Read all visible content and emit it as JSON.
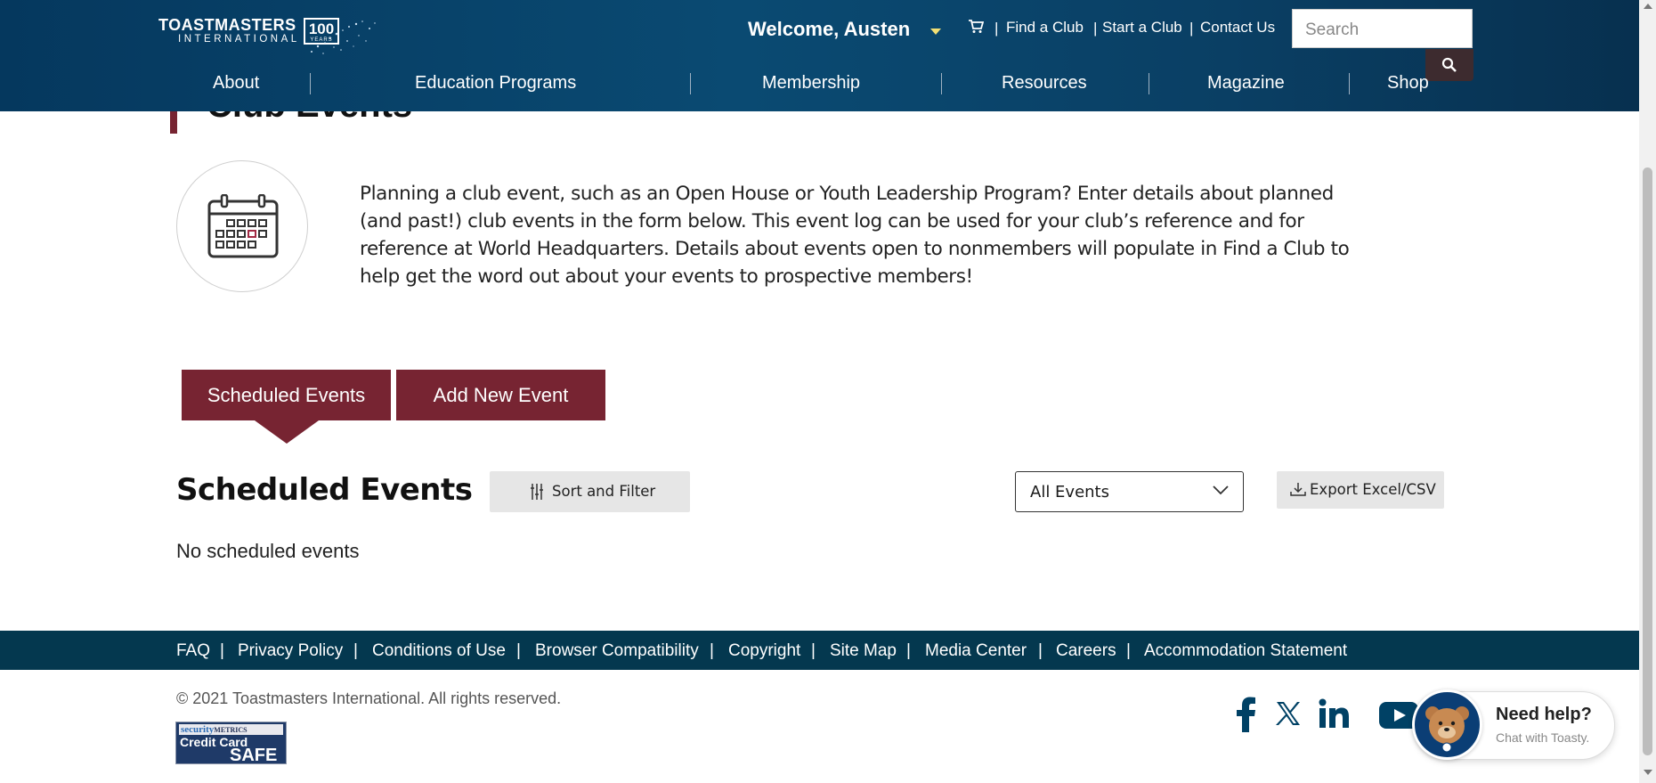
{
  "header": {
    "brand": "TOASTMASTERS",
    "brand_sub": "INTERNATIONAL",
    "anniversary_number": "100",
    "anniversary_word": "YEARS",
    "welcome": "Welcome, Austen",
    "utility_links": [
      "Find a Club",
      "Start a Club",
      "Contact Us"
    ],
    "search_placeholder": "Search",
    "nav": [
      "About",
      "Education Programs",
      "Membership",
      "Resources",
      "Magazine",
      "Shop"
    ]
  },
  "main": {
    "page_title": "Club Events",
    "intro": "Planning a club event, such as an Open House or Youth Leadership Program? Enter details about planned (and past!) club events in the form below. This event log can be used for your club’s reference and for reference at World Headquarters. Details about events open to nonmembers will populate in Find a Club to help get the word out about your events to prospective members!",
    "tabs": [
      {
        "label": "Scheduled Events",
        "active": true
      },
      {
        "label": "Add New Event",
        "active": false
      }
    ],
    "section_title": "Scheduled Events",
    "sort_filter_label": "Sort and Filter",
    "event_filter_value": "All Events",
    "export_label": "Export Excel/CSV",
    "empty_message": "No scheduled events"
  },
  "footer": {
    "links": [
      "FAQ",
      "Privacy Policy",
      "Conditions of Use",
      "Browser Compatibility",
      "Copyright",
      "Site Map",
      "Media Center",
      "Careers",
      "Accommodation Statement"
    ],
    "copyright": "© 2021 Toastmasters International.  All rights reserved.",
    "badge_brand_a": "security",
    "badge_brand_b": "METRICS",
    "badge_line1": "Credit Card",
    "badge_line2": "SAFE",
    "social_icons": [
      "facebook-icon",
      "x-twitter-icon",
      "linkedin-icon",
      "youtube-icon"
    ],
    "help_title": "Need help?",
    "help_subtitle": "Chat with Toasty."
  },
  "colors": {
    "header_bg": "#0a4a72",
    "brand_maroon": "#772432",
    "footer_bg": "#04384f",
    "accent_yellow": "#f2df74",
    "social_blue": "#004165"
  }
}
